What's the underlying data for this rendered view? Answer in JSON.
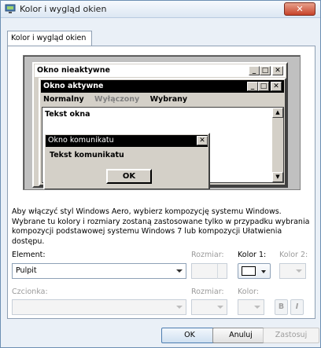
{
  "window": {
    "title": "Kolor i wygląd okien",
    "close_glyph": "✕"
  },
  "tab": {
    "label": "Kolor i wygląd okien"
  },
  "preview": {
    "inactive_title": "Okno nieaktywne",
    "active_title": "Okno aktywne",
    "menu_normal": "Normalny",
    "menu_disabled": "Wyłączony",
    "menu_selected": "Wybrany",
    "window_text": "Tekst okna",
    "message_title": "Okno komunikatu",
    "message_text": "Tekst komunikatu",
    "message_ok": "OK",
    "btn_min": "_",
    "btn_max": "□",
    "btn_close": "✕",
    "scroll_up": "▲",
    "scroll_down": "▼"
  },
  "description": "Aby włączyć styl Windows Aero, wybierz kompozycję systemu Windows. Wybrane tu kolory i rozmiary zostaną zastosowane tylko w przypadku wybrania kompozycji podstawowej systemu Windows 7 lub kompozycji Ułatwienia dostępu.",
  "form": {
    "element_label": "Element:",
    "element_value": "Pulpit",
    "size_label": "Rozmiar:",
    "color1_label": "Kolor 1:",
    "color2_label": "Kolor 2:",
    "font_label": "Czcionka:",
    "font_size_label": "Rozmiar:",
    "font_color_label": "Kolor:",
    "bold_label": "B",
    "italic_label": "I",
    "color1_value": "#ffffff"
  },
  "buttons": {
    "ok": "OK",
    "cancel": "Anuluj",
    "apply": "Zastosuj"
  }
}
